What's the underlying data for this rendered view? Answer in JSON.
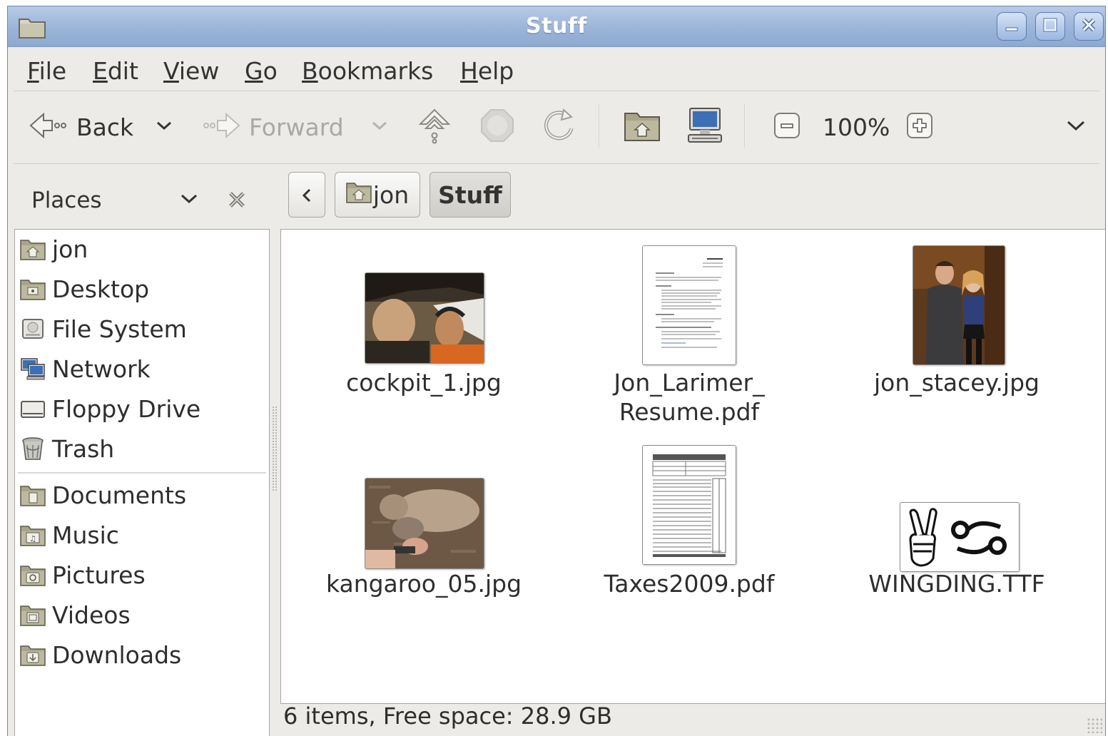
{
  "window": {
    "title": "Stuff",
    "title_bar_color": "#9bb4d8",
    "controls": [
      "minimize-icon",
      "maximize-icon",
      "close-icon"
    ]
  },
  "menu": {
    "items": [
      {
        "label": "File",
        "mnemonic": "F"
      },
      {
        "label": "Edit",
        "mnemonic": "E"
      },
      {
        "label": "View",
        "mnemonic": "V"
      },
      {
        "label": "Go",
        "mnemonic": "G"
      },
      {
        "label": "Bookmarks",
        "mnemonic": "B"
      },
      {
        "label": "Help",
        "mnemonic": "H"
      }
    ]
  },
  "toolbar": {
    "back_label": "Back",
    "forward_label": "Forward",
    "zoom_level": "100%",
    "icons": [
      "back-arrow-icon",
      "up-icon",
      "stop-icon",
      "reload-icon",
      "home-icon",
      "computer-icon",
      "zoom-out-icon",
      "zoom-in-icon"
    ]
  },
  "sidebar": {
    "header": "Places",
    "items": [
      {
        "label": "jon",
        "icon": "home-folder-icon"
      },
      {
        "label": "Desktop",
        "icon": "desktop-folder-icon"
      },
      {
        "label": "File System",
        "icon": "drive-icon"
      },
      {
        "label": "Network",
        "icon": "network-icon"
      },
      {
        "label": "Floppy Drive",
        "icon": "floppy-icon"
      },
      {
        "label": "Trash",
        "icon": "trash-icon"
      },
      {
        "label": "Documents",
        "icon": "documents-folder-icon"
      },
      {
        "label": "Music",
        "icon": "music-folder-icon"
      },
      {
        "label": "Pictures",
        "icon": "pictures-folder-icon"
      },
      {
        "label": "Videos",
        "icon": "videos-folder-icon"
      },
      {
        "label": "Downloads",
        "icon": "downloads-folder-icon"
      }
    ]
  },
  "pathbar": {
    "crumbs": [
      {
        "label": "jon",
        "active": false
      },
      {
        "label": "Stuff",
        "active": true
      }
    ]
  },
  "files": [
    {
      "name": "cockpit_1.jpg",
      "kind": "photo"
    },
    {
      "name_line1": "Jon_Larimer_",
      "name_line2": "Resume.pdf",
      "kind": "pdf"
    },
    {
      "name": "jon_stacey.jpg",
      "kind": "photo"
    },
    {
      "name": "kangaroo_05.jpg",
      "kind": "photo"
    },
    {
      "name": "Taxes2009.pdf",
      "kind": "pdf"
    },
    {
      "name": "WINGDING.TTF",
      "kind": "font",
      "preview": "✌♋"
    }
  ],
  "status": {
    "text": "6 items, Free space: 28.9 GB"
  }
}
